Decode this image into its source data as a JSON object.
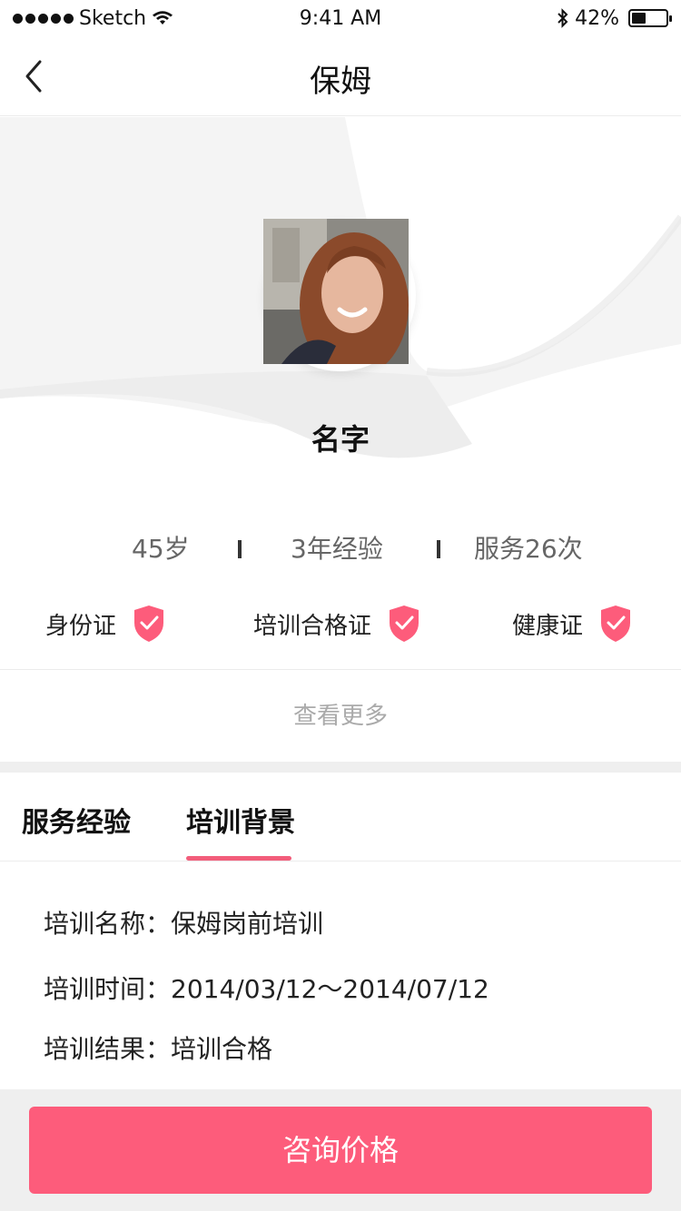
{
  "status_bar": {
    "carrier": "Sketch",
    "time": "9:41 AM",
    "battery": "42%",
    "battery_level": 0.42
  },
  "nav": {
    "title": "保姆"
  },
  "profile": {
    "name": "名字"
  },
  "stats": {
    "age": "45岁",
    "experience": "3年经验",
    "service_count": "服务26次"
  },
  "certificates": [
    {
      "label": "身份证"
    },
    {
      "label": "培训合格证"
    },
    {
      "label": "健康证"
    }
  ],
  "more_label": "查看更多",
  "tabs": [
    {
      "label": "服务经验"
    },
    {
      "label": "培训背景",
      "active": true
    }
  ],
  "training": {
    "name_label": "培训名称：",
    "name_value": "保姆岗前培训",
    "time_label": "培训时间：",
    "time_value": "2014/03/12～2014/07/12",
    "result_label": "培训结果：",
    "result_value": "培训合格"
  },
  "cta": {
    "label": "咨询价格"
  },
  "colors": {
    "accent": "#fd5c7b",
    "underline": "#f25d7b"
  }
}
